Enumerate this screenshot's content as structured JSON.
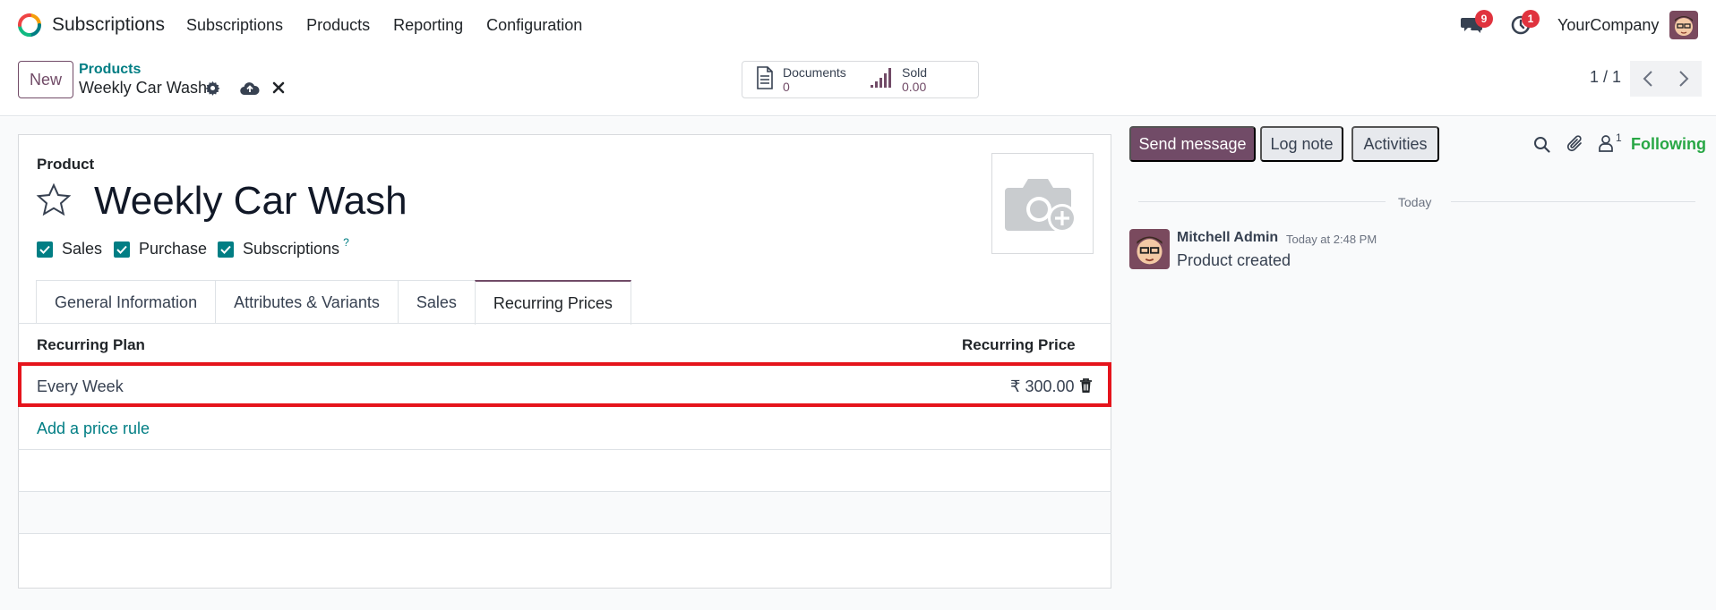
{
  "navbar": {
    "app_name": "Subscriptions",
    "menu": [
      "Subscriptions",
      "Products",
      "Reporting",
      "Configuration"
    ],
    "messages_badge": "9",
    "activities_badge": "1",
    "company": "YourCompany"
  },
  "control": {
    "new_label": "New",
    "breadcrumb_parent": "Products",
    "breadcrumb_current": "Weekly Car Wash",
    "stats": {
      "documents_label": "Documents",
      "documents_value": "0",
      "sold_label": "Sold",
      "sold_value": "0.00"
    },
    "pager": "1 / 1"
  },
  "form": {
    "section_label": "Product",
    "name": "Weekly Car Wash",
    "checkboxes": [
      {
        "label": "Sales",
        "checked": true
      },
      {
        "label": "Purchase",
        "checked": true
      },
      {
        "label": "Subscriptions",
        "checked": true,
        "help": "?"
      }
    ],
    "tabs": [
      "General Information",
      "Attributes & Variants",
      "Sales",
      "Recurring Prices"
    ],
    "active_tab": "Recurring Prices",
    "table": {
      "headers": [
        "Recurring Plan",
        "Recurring Price"
      ],
      "rows": [
        {
          "plan": "Every Week",
          "price": "₹ 300.00"
        }
      ],
      "add_label": "Add a price rule"
    }
  },
  "chatter": {
    "send_message": "Send message",
    "log_note": "Log note",
    "activities": "Activities",
    "followers_count": "1",
    "following": "Following",
    "date_separator": "Today",
    "message": {
      "author": "Mitchell Admin",
      "time": "Today at 2:48 PM",
      "body": "Product created"
    }
  },
  "colors": {
    "brand": "#714b67",
    "link": "#017e84",
    "highlight": "#e5141c",
    "following": "#28a745",
    "badge": "#e0333e"
  }
}
